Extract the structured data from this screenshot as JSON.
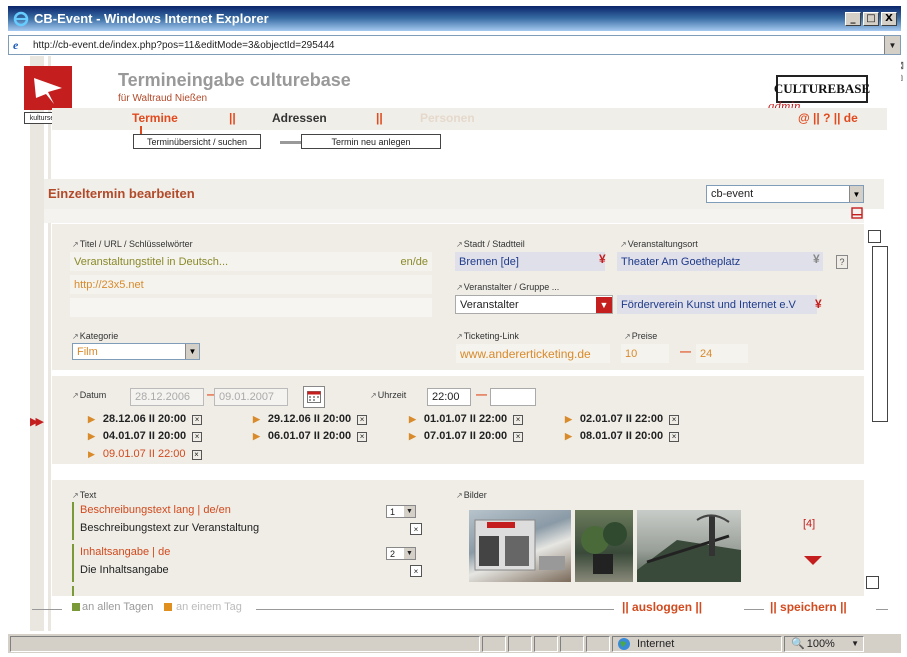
{
  "window": {
    "title": "CB-Event - Windows Internet Explorer",
    "minimize": "_",
    "maximize": "□",
    "close": "X"
  },
  "address": {
    "url": "http://cb-event.de/index.php?pos=11&editMode=3&objectId=295444"
  },
  "header": {
    "title": "Termineingabe culturebase",
    "user": "für  Waltraud Nießen",
    "logo_text": "kulturserver",
    "brand": "CULTUREBASE",
    "brand_admin": "admin"
  },
  "nav": {
    "termine": "Termine",
    "adressen": "Adressen",
    "personen": "Personen",
    "sep": "||",
    "right": "@  ||  ?  ||  de"
  },
  "subtabs": {
    "search": "Terminübersicht / suchen",
    "new": "Termin neu anlegen"
  },
  "section": {
    "title": "Einzeltermin bearbeiten",
    "selector": "cb-event"
  },
  "form": {
    "title_label": "Titel / URL / Schlüsselwörter",
    "title_value": "Veranstaltungstitel in Deutsch...",
    "title_lang": "en/de",
    "url_value": "http://23x5.net",
    "category_label": "Kategorie",
    "category_value": "Film",
    "city_label": "Stadt / Stadtteil",
    "city_value": "Bremen [de]",
    "venue_label": "Veranstaltungsort",
    "venue_value": "Theater Am Goetheplatz",
    "help": "?",
    "organizer_label": "Veranstalter / Gruppe ...",
    "organizer_select": "Veranstalter",
    "organizer_value": "Förderverein Kunst und Internet e.V",
    "ticket_label": "Ticketing-Link",
    "ticket_value": "www.andererticketing.de",
    "price_label": "Preise",
    "price_from": "10",
    "price_dash": "—",
    "price_to": "24"
  },
  "dates": {
    "date_label": "Datum",
    "date_from": "28.12.2006",
    "date_to": "09.01.2007",
    "dash": "—",
    "time_label": "Uhrzeit",
    "time_from": "22:00",
    "items": [
      "28.12.06  II  20:00",
      "29.12.06  II  20:00",
      "01.01.07  II  22:00",
      "02.01.07  II  22:00",
      "04.01.07  II  20:00",
      "06.01.07  II  20:00",
      "07.01.07  II  20:00",
      "08.01.07  II  20:00",
      "09.01.07  II  22:00"
    ]
  },
  "text_section": {
    "label": "Text",
    "desc_head": "Beschreibungstext lang  | de/en",
    "desc_num": "1",
    "desc_value": "Beschreibungstext zur Veranstaltung",
    "summary_head": "Inhaltsangabe  | de",
    "summary_num": "2",
    "summary_value": "Die Inhaltsangabe"
  },
  "images": {
    "label": "Bilder",
    "count": "[4]"
  },
  "footer": {
    "all_days": "an allen Tagen",
    "one_day": "an einem Tag",
    "logout": "||  ausloggen  ||",
    "save": "||  speichern  ||"
  },
  "statusbar": {
    "zone": "Internet",
    "zoom": "100%"
  },
  "colors": {
    "accent": "#e04a1e",
    "brand_red": "#c41e1e",
    "panel": "#efede6"
  }
}
